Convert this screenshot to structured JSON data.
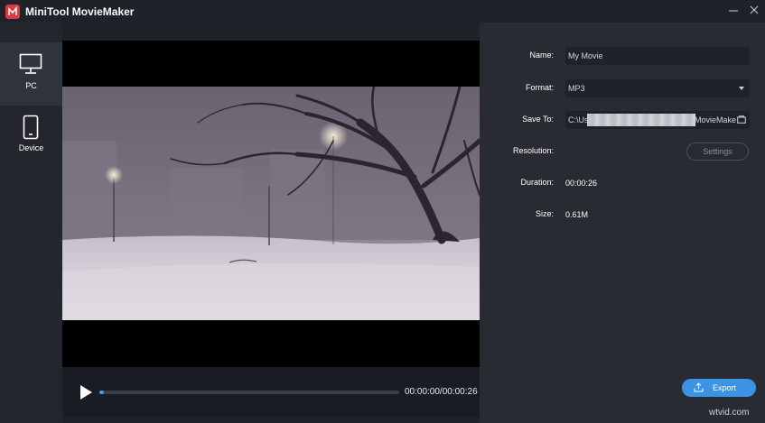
{
  "window": {
    "title": "MiniTool MovieMaker"
  },
  "sidebar": {
    "items": [
      {
        "label": "PC",
        "icon": "monitor-icon",
        "active": true
      },
      {
        "label": "Device",
        "icon": "phone-icon",
        "active": false
      }
    ]
  },
  "player": {
    "timecode": "00:00:00/00:00:26",
    "progress_percent": 1.5
  },
  "export_settings": {
    "name_label": "Name:",
    "name_value": "My Movie",
    "format_label": "Format:",
    "format_value": "MP3",
    "save_to_label": "Save To:",
    "save_to_prefix": "C:\\Use",
    "save_to_suffix": "MovieMake",
    "resolution_label": "Resolution:",
    "settings_button": "Settings",
    "duration_label": "Duration:",
    "duration_value": "00:00:26",
    "size_label": "Size:",
    "size_value": "0.61M",
    "export_button": "Export"
  },
  "watermark": "wtvid.com",
  "colors": {
    "accent": "#3b93e3",
    "background": "#1e2128",
    "panel": "#282b32",
    "logo": "#e0383e"
  }
}
